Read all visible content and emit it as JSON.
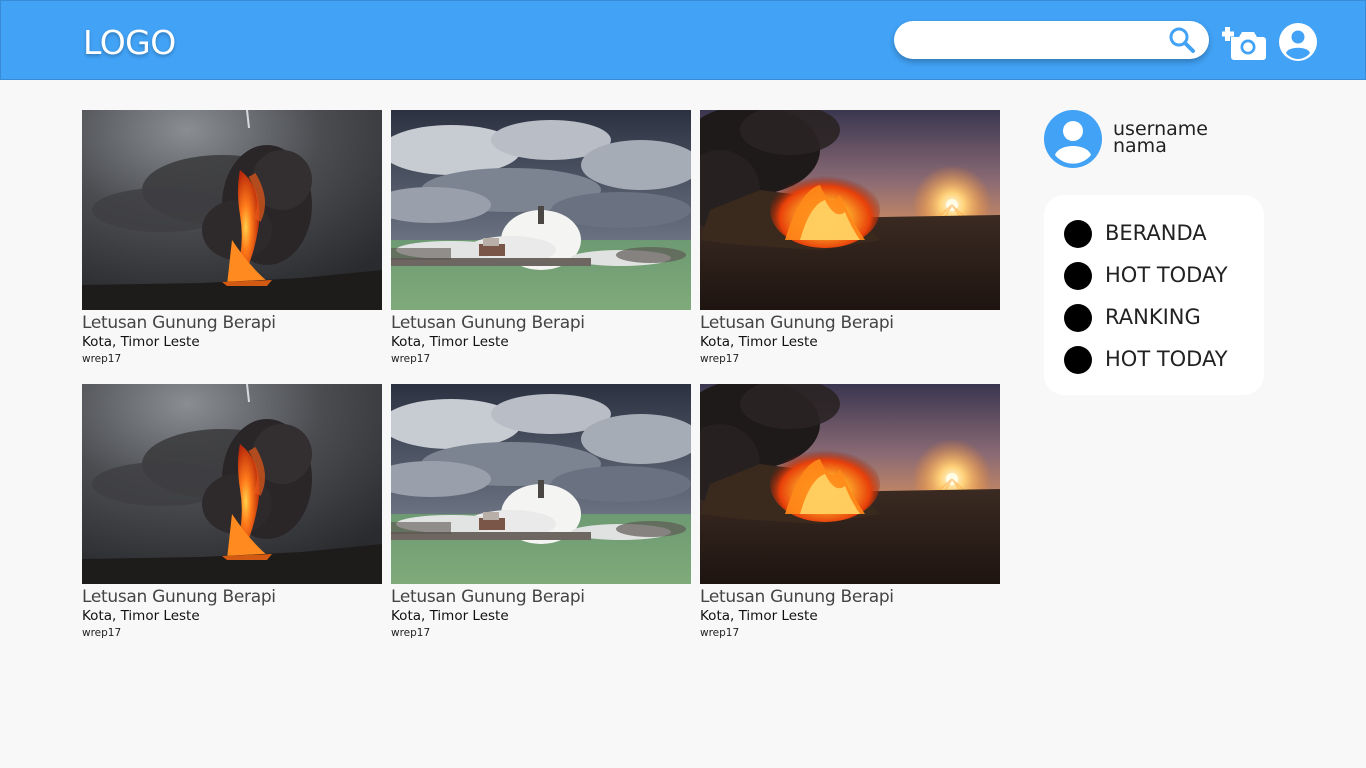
{
  "header": {
    "logo": "LOGO",
    "search": {
      "value": "",
      "placeholder": ""
    },
    "background": "#42a2f5"
  },
  "cards": [
    {
      "image": "volcano-eruption",
      "title": "Letusan Gunung Berapi",
      "location": "Kota, Timor Leste",
      "user": "wrep17"
    },
    {
      "image": "stormy-sea-lighthouse",
      "title": "Letusan Gunung Berapi",
      "location": "Kota, Timor Leste",
      "user": "wrep17"
    },
    {
      "image": "bonfire-sunset",
      "title": "Letusan Gunung Berapi",
      "location": "Kota, Timor Leste",
      "user": "wrep17"
    },
    {
      "image": "volcano-eruption",
      "title": "Letusan Gunung Berapi",
      "location": "Kota, Timor Leste",
      "user": "wrep17"
    },
    {
      "image": "stormy-sea-lighthouse",
      "title": "Letusan Gunung Berapi",
      "location": "Kota, Timor Leste",
      "user": "wrep17"
    },
    {
      "image": "bonfire-sunset",
      "title": "Letusan Gunung Berapi",
      "location": "Kota, Timor Leste",
      "user": "wrep17"
    }
  ],
  "profile": {
    "username": "username",
    "name": "nama",
    "avatar_icon": "account-circle-icon",
    "accent": "#42a2f5"
  },
  "menu": {
    "items": [
      {
        "label": "BERANDA",
        "icon": "bullet-icon"
      },
      {
        "label": "HOT TODAY",
        "icon": "bullet-icon"
      },
      {
        "label": "RANKING",
        "icon": "bullet-icon"
      },
      {
        "label": "HOT TODAY",
        "icon": "bullet-icon"
      }
    ]
  }
}
